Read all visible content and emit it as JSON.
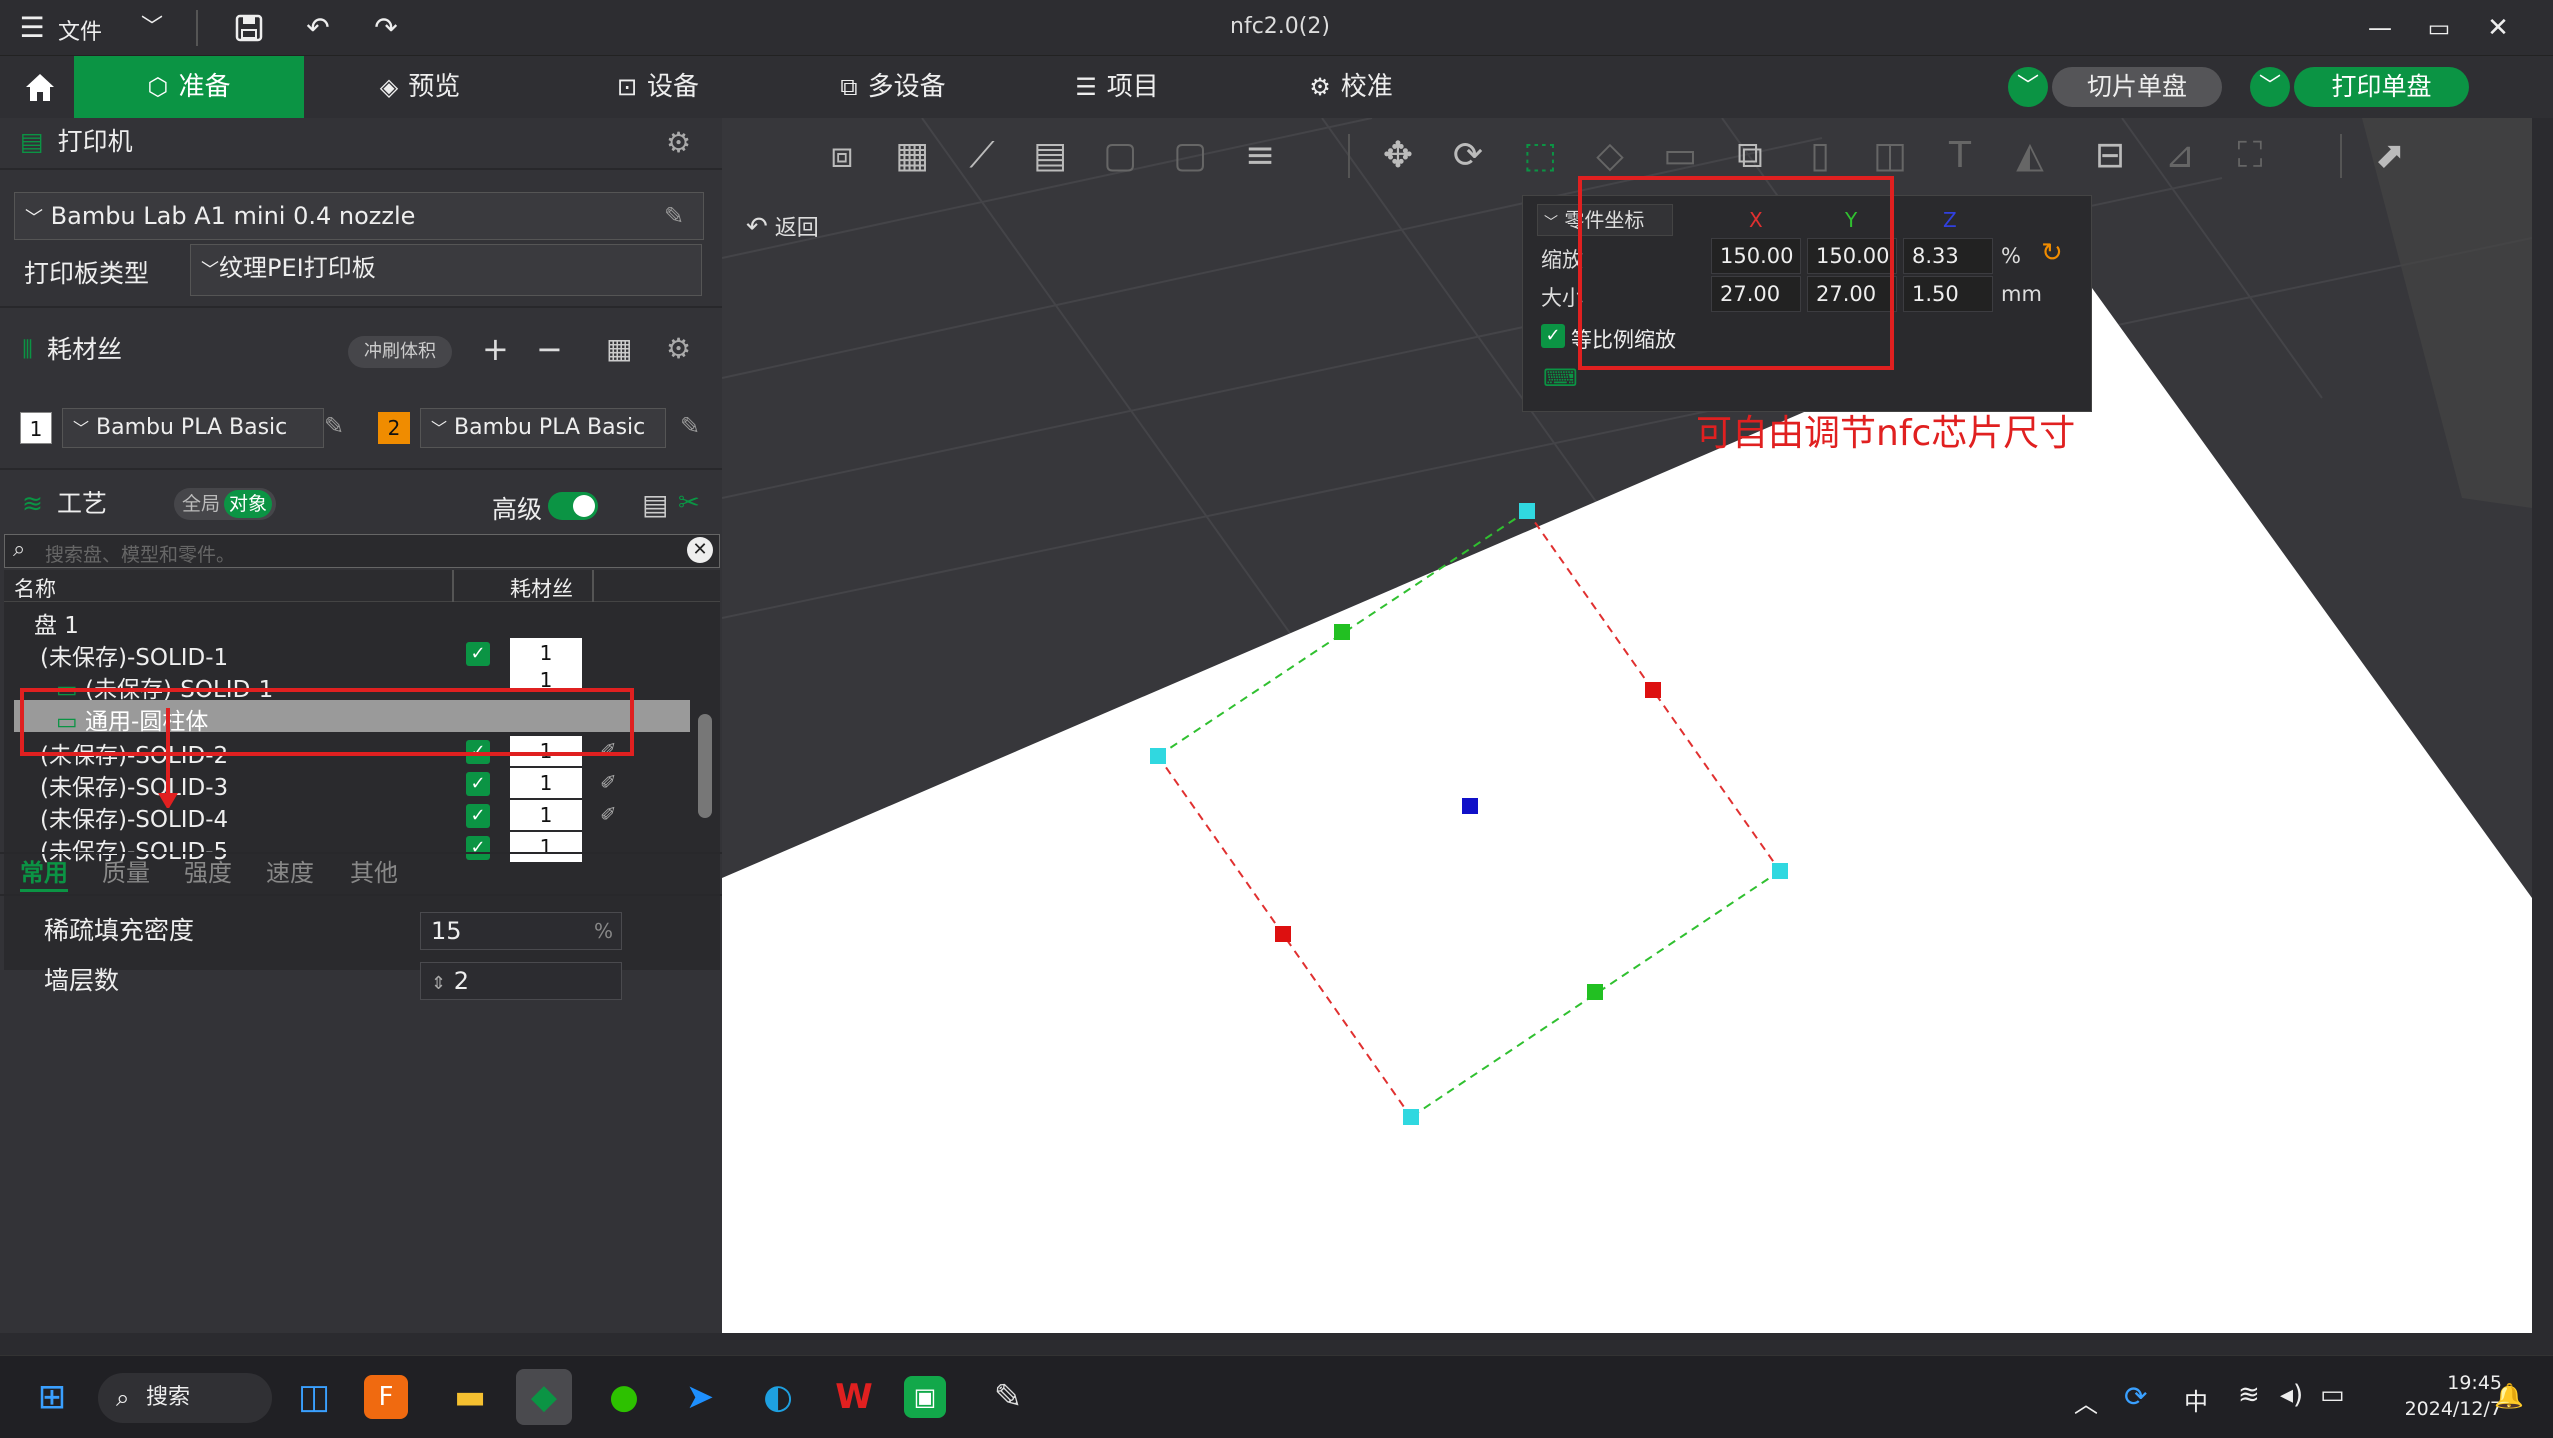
{
  "window": {
    "title": "nfc2.0(2)",
    "menu_label": "文件"
  },
  "nav": {
    "tabs": [
      {
        "label": "准备",
        "active": true
      },
      {
        "label": "预览"
      },
      {
        "label": "设备"
      },
      {
        "label": "多设备"
      },
      {
        "label": "项目"
      },
      {
        "label": "校准"
      }
    ],
    "slice_button": "切片单盘",
    "print_button": "打印单盘"
  },
  "left": {
    "printer_title": "打印机",
    "printer_name": "Bambu Lab A1 mini 0.4 nozzle",
    "plate_type_label": "打印板类型",
    "plate_type_value": "纹理PEI打印板",
    "filament_title": "耗材丝",
    "flush_button": "冲刷体积",
    "filaments": [
      {
        "index": "1",
        "name": "Bambu PLA Basic",
        "color": "#ffffff"
      },
      {
        "index": "2",
        "name": "Bambu PLA Basic",
        "color": "#f08c00"
      }
    ],
    "process_title": "工艺",
    "global_label": "全局",
    "object_label": "对象",
    "advanced_label": "高级",
    "search_placeholder": "搜索盘、模型和零件。",
    "col_name": "名称",
    "col_filament": "耗材丝",
    "tree": [
      {
        "label": "盘 1",
        "level": 0
      },
      {
        "label": "(未保存)-SOLID-1",
        "level": 1,
        "filament": "1"
      },
      {
        "label": "(未保存)-SOLID-1",
        "level": 2,
        "filament": "1"
      },
      {
        "label": "通用-圆柱体",
        "level": 2,
        "selected": true
      },
      {
        "label": "(未保存)-SOLID-2",
        "level": 1,
        "filament": "1"
      },
      {
        "label": "(未保存)-SOLID-3",
        "level": 1,
        "filament": "1"
      },
      {
        "label": "(未保存)-SOLID-4",
        "level": 1,
        "filament": "1"
      },
      {
        "label": "(未保存)-SOLID-5",
        "level": 1,
        "filament": "1"
      }
    ],
    "settings_tabs": [
      "常用",
      "质量",
      "强度",
      "速度",
      "其他"
    ],
    "infill_label": "稀疏填充密度",
    "infill_value": "15",
    "infill_unit": "%",
    "walls_label": "墙层数",
    "walls_value": "2"
  },
  "viewport": {
    "back_label": "返回",
    "coord": {
      "mode": "零件坐标",
      "axis_x": "X",
      "axis_y": "Y",
      "axis_z": "Z",
      "scale_label": "缩放",
      "scale_x": "150.00",
      "scale_y": "150.00",
      "scale_z": "8.33",
      "scale_unit": "%",
      "size_label": "大小",
      "size_x": "27.00",
      "size_y": "27.00",
      "size_z": "1.50",
      "size_unit": "mm",
      "uniform_label": "等比例缩放"
    },
    "annotation": "可自由调节nfc芯片尺寸"
  },
  "taskbar": {
    "search_label": "搜索",
    "ime": "中",
    "time": "19:45",
    "date": "2024/12/7"
  },
  "colors": {
    "accent": "#0b9444",
    "annotation_red": "#e02020"
  }
}
